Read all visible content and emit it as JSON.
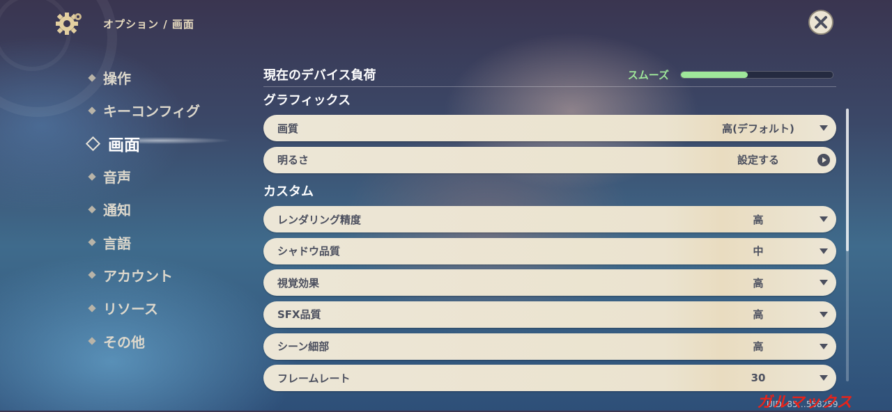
{
  "header": {
    "breadcrumb": "オプション / 画面"
  },
  "nav": {
    "items": [
      "操作",
      "キーコンフィグ",
      "画面",
      "音声",
      "通知",
      "言語",
      "アカウント",
      "リソース",
      "その他"
    ],
    "active_index": 2
  },
  "device_load": {
    "title": "現在のデバイス負荷",
    "status": "スムーズ",
    "level_percent": 44,
    "status_color": "#9fe79a"
  },
  "graphics": {
    "title": "グラフィックス",
    "rows": [
      {
        "label": "画質",
        "value": "高(デフォルト)",
        "control": "dropdown"
      },
      {
        "label": "明るさ",
        "value": "設定する",
        "control": "goto"
      }
    ]
  },
  "custom": {
    "title": "カスタム",
    "rows": [
      {
        "label": "レンダリング精度",
        "value": "高",
        "control": "dropdown"
      },
      {
        "label": "シャドウ品質",
        "value": "中",
        "control": "dropdown"
      },
      {
        "label": "視覚効果",
        "value": "高",
        "control": "dropdown"
      },
      {
        "label": "SFX品質",
        "value": "高",
        "control": "dropdown"
      },
      {
        "label": "シーン細部",
        "value": "高",
        "control": "dropdown"
      },
      {
        "label": "フレームレート",
        "value": "30",
        "control": "dropdown"
      }
    ]
  },
  "footer": {
    "watermark": "ガルマックス",
    "uid_text": "UID: 85…558259"
  },
  "icons": {
    "settings": "gear-icon",
    "close": "close-icon",
    "dropdown": "chevron-down-icon",
    "goto": "arrow-right-circle-icon"
  }
}
